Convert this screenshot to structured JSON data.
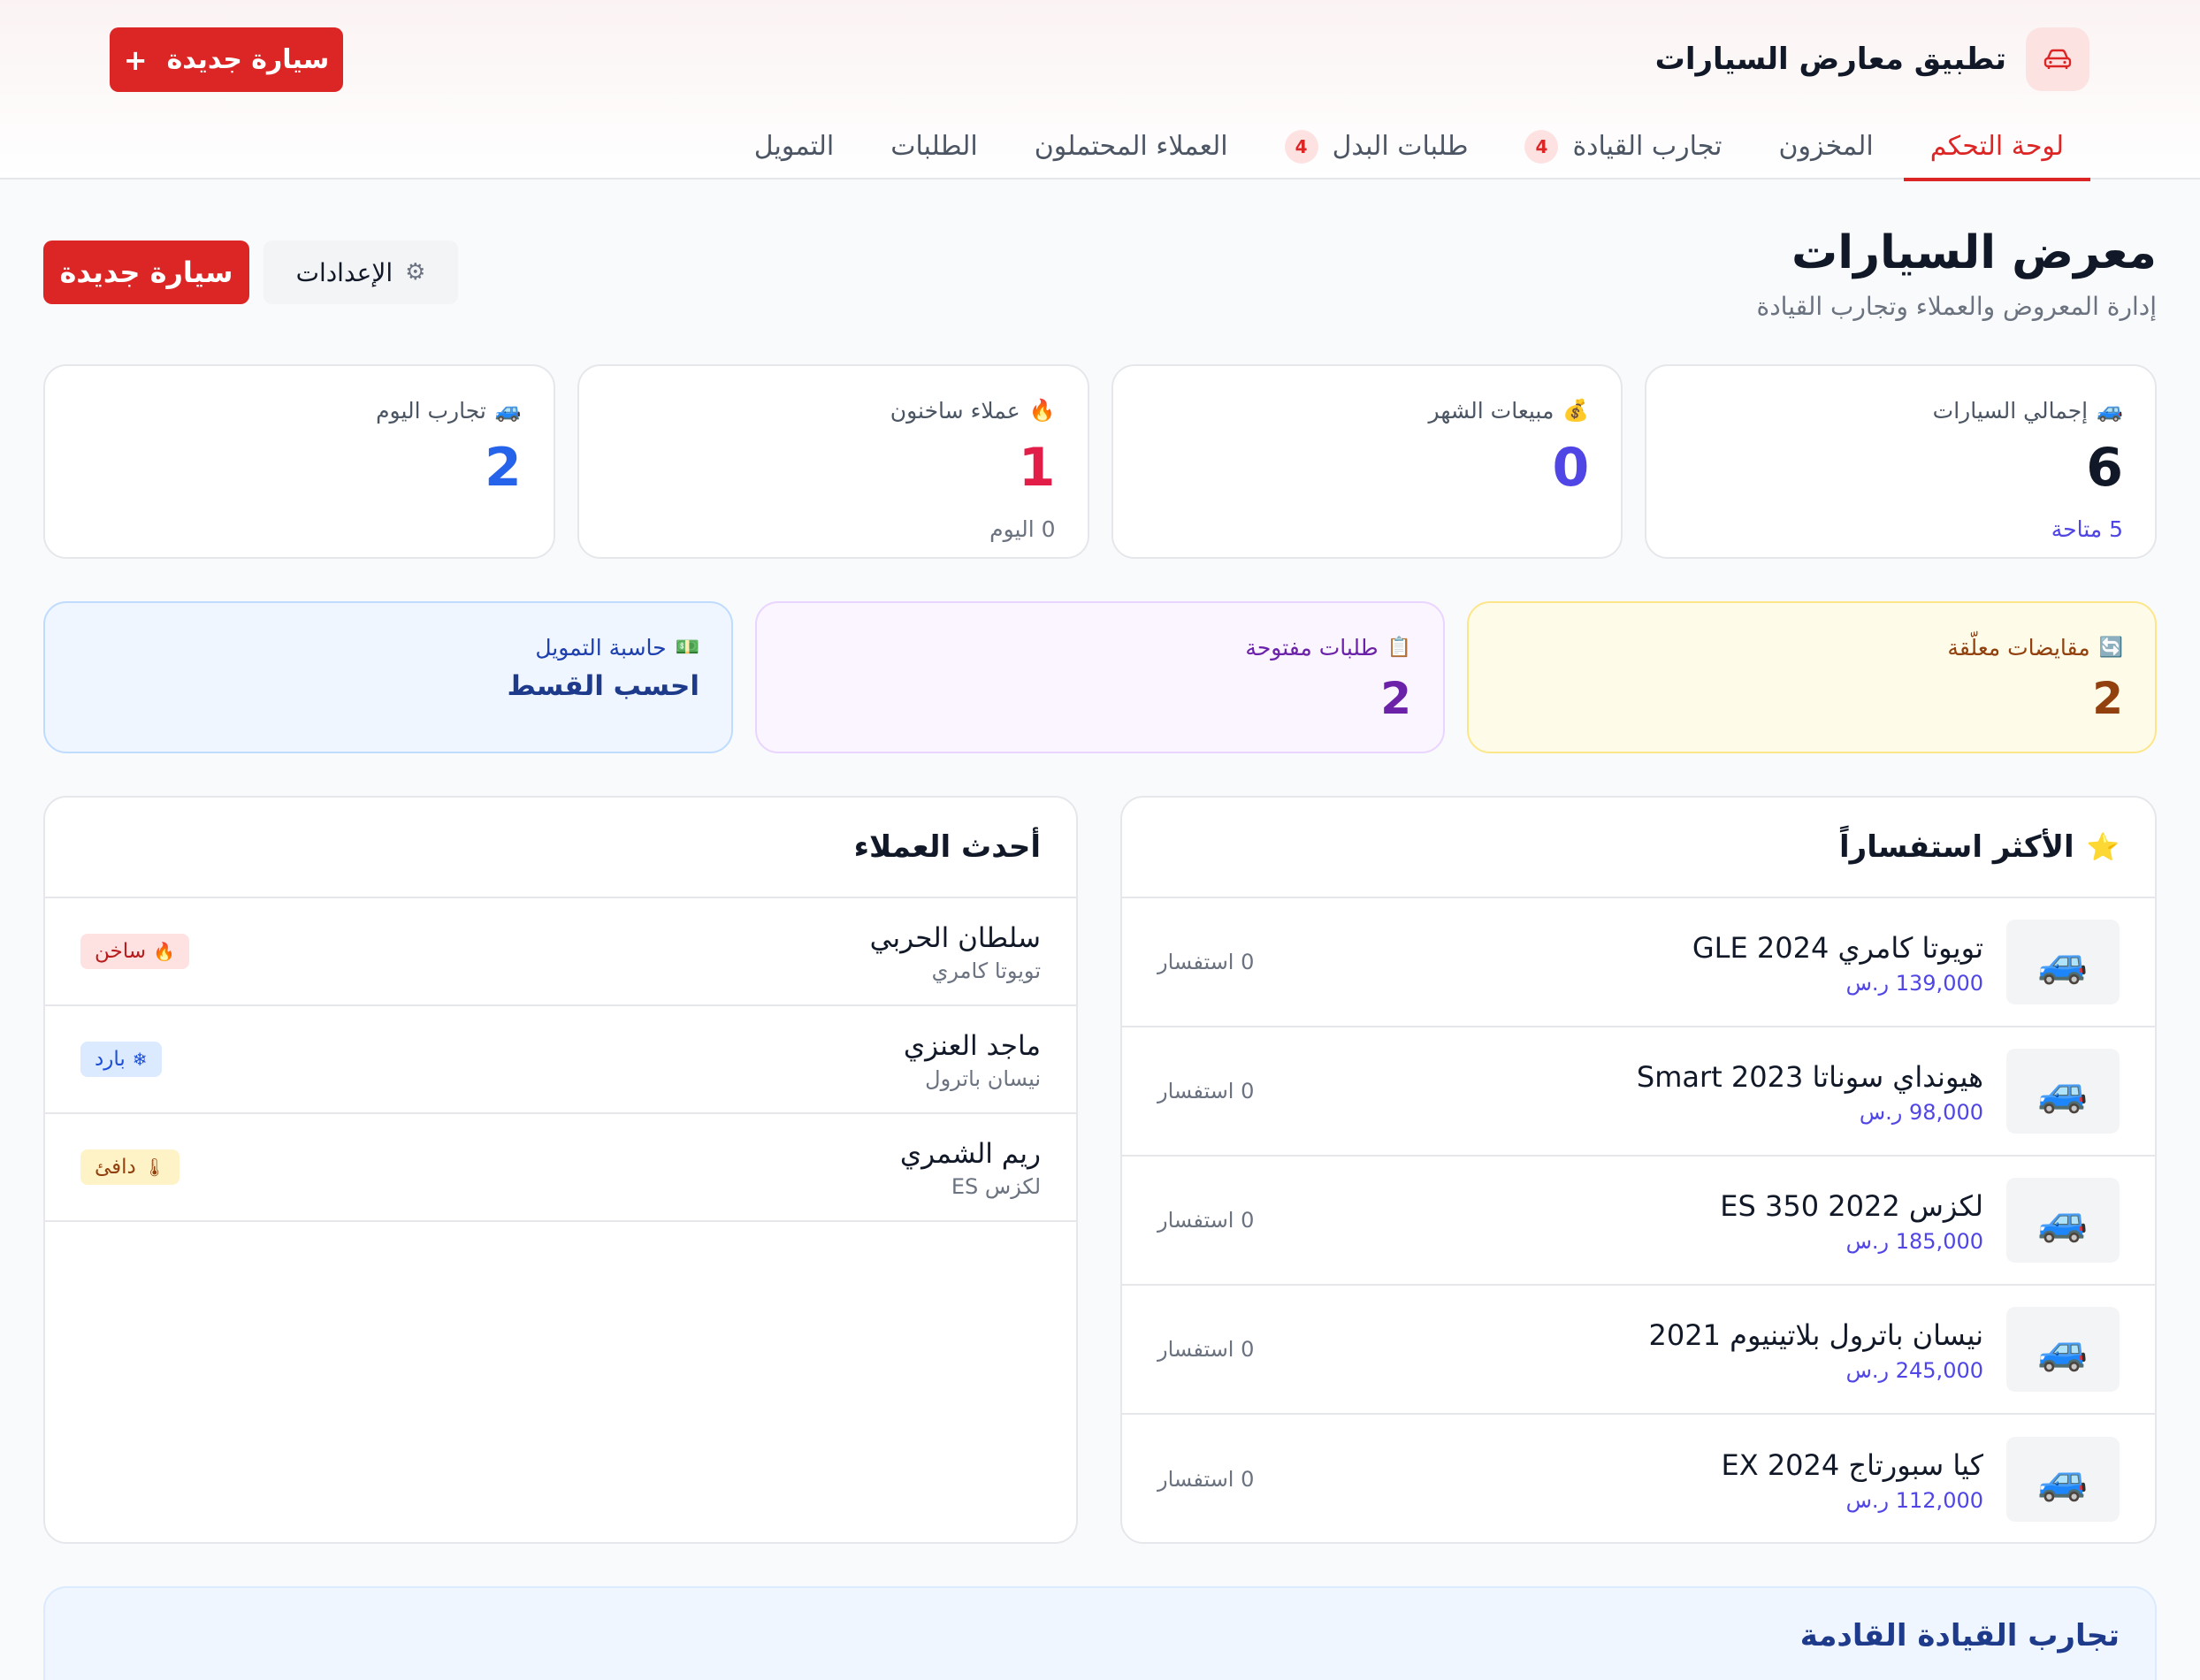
{
  "app": {
    "title": "تطبيق معارض السيارات",
    "header_new_button": "سيارة جديدة",
    "accent_color": "#dc2626"
  },
  "nav": {
    "tabs": [
      {
        "label": "لوحة التحكم",
        "active": true,
        "badge": ""
      },
      {
        "label": "المخزون",
        "active": false,
        "badge": ""
      },
      {
        "label": "تجارب القيادة",
        "active": false,
        "badge": "4"
      },
      {
        "label": "طلبات البدل",
        "active": false,
        "badge": "4"
      },
      {
        "label": "العملاء المحتملون",
        "active": false,
        "badge": ""
      },
      {
        "label": "الطلبات",
        "active": false,
        "badge": ""
      },
      {
        "label": "التمويل",
        "active": false,
        "badge": ""
      }
    ]
  },
  "page": {
    "title": "معرض السيارات",
    "subtitle": "إدارة المعروض والعملاء وتجارب القيادة",
    "new_car_button": "سيارة جديدة",
    "settings_button": "الإعدادات"
  },
  "stats": [
    {
      "icon": "car-icon",
      "label": "إجمالي السيارات",
      "value": "6",
      "sub": "5 متاحة",
      "value_color": "#111827"
    },
    {
      "icon": "money-bag-icon",
      "label": "مبيعات الشهر",
      "value": "0",
      "sub": "",
      "value_color": "#4f46e5"
    },
    {
      "icon": "fire-icon",
      "label": "عملاء ساخنون",
      "value": "1",
      "sub": "0 اليوم",
      "value_color": "#e11d48"
    },
    {
      "icon": "car-side-icon",
      "label": "تجارب اليوم",
      "value": "2",
      "sub": "",
      "value_color": "#2563eb"
    }
  ],
  "highlights": {
    "trades": {
      "icon": "refresh-icon",
      "label": "مقايضات معلّقة",
      "value": "2"
    },
    "orders": {
      "icon": "clipboard-icon",
      "label": "طلبات مفتوحة",
      "value": "2"
    },
    "finance": {
      "icon": "cash-icon",
      "label": "حاسبة التمويل",
      "link": "احسب القسط"
    }
  },
  "popular": {
    "title": "الأكثر استفساراً",
    "cars": [
      {
        "name": "تويوتا كامري GLE 2024",
        "price": "139,000 ر.س",
        "inquiries": "0 استفسار"
      },
      {
        "name": "هيونداي سوناتا Smart 2023",
        "price": "98,000 ر.س",
        "inquiries": "0 استفسار"
      },
      {
        "name": "لكزس ES 350 2022",
        "price": "185,000 ر.س",
        "inquiries": "0 استفسار"
      },
      {
        "name": "نيسان باترول بلاتينيوم 2021",
        "price": "245,000 ر.س",
        "inquiries": "0 استفسار"
      },
      {
        "name": "كيا سبورتاج EX 2024",
        "price": "112,000 ر.س",
        "inquiries": "0 استفسار"
      }
    ]
  },
  "customers": {
    "title": "أحدث العملاء",
    "list": [
      {
        "name": "سلطان الحربي",
        "car": "تويوتا كامري",
        "temp": "ساخن",
        "temp_type": "hot"
      },
      {
        "name": "ماجد العنزي",
        "car": "نيسان باترول",
        "temp": "بارد",
        "temp_type": "cold"
      },
      {
        "name": "ريم الشمري",
        "car": "لكزس ES",
        "temp": "دافئ",
        "temp_type": "warm"
      }
    ]
  },
  "upcoming": {
    "title": "تجارب القيادة القادمة"
  }
}
